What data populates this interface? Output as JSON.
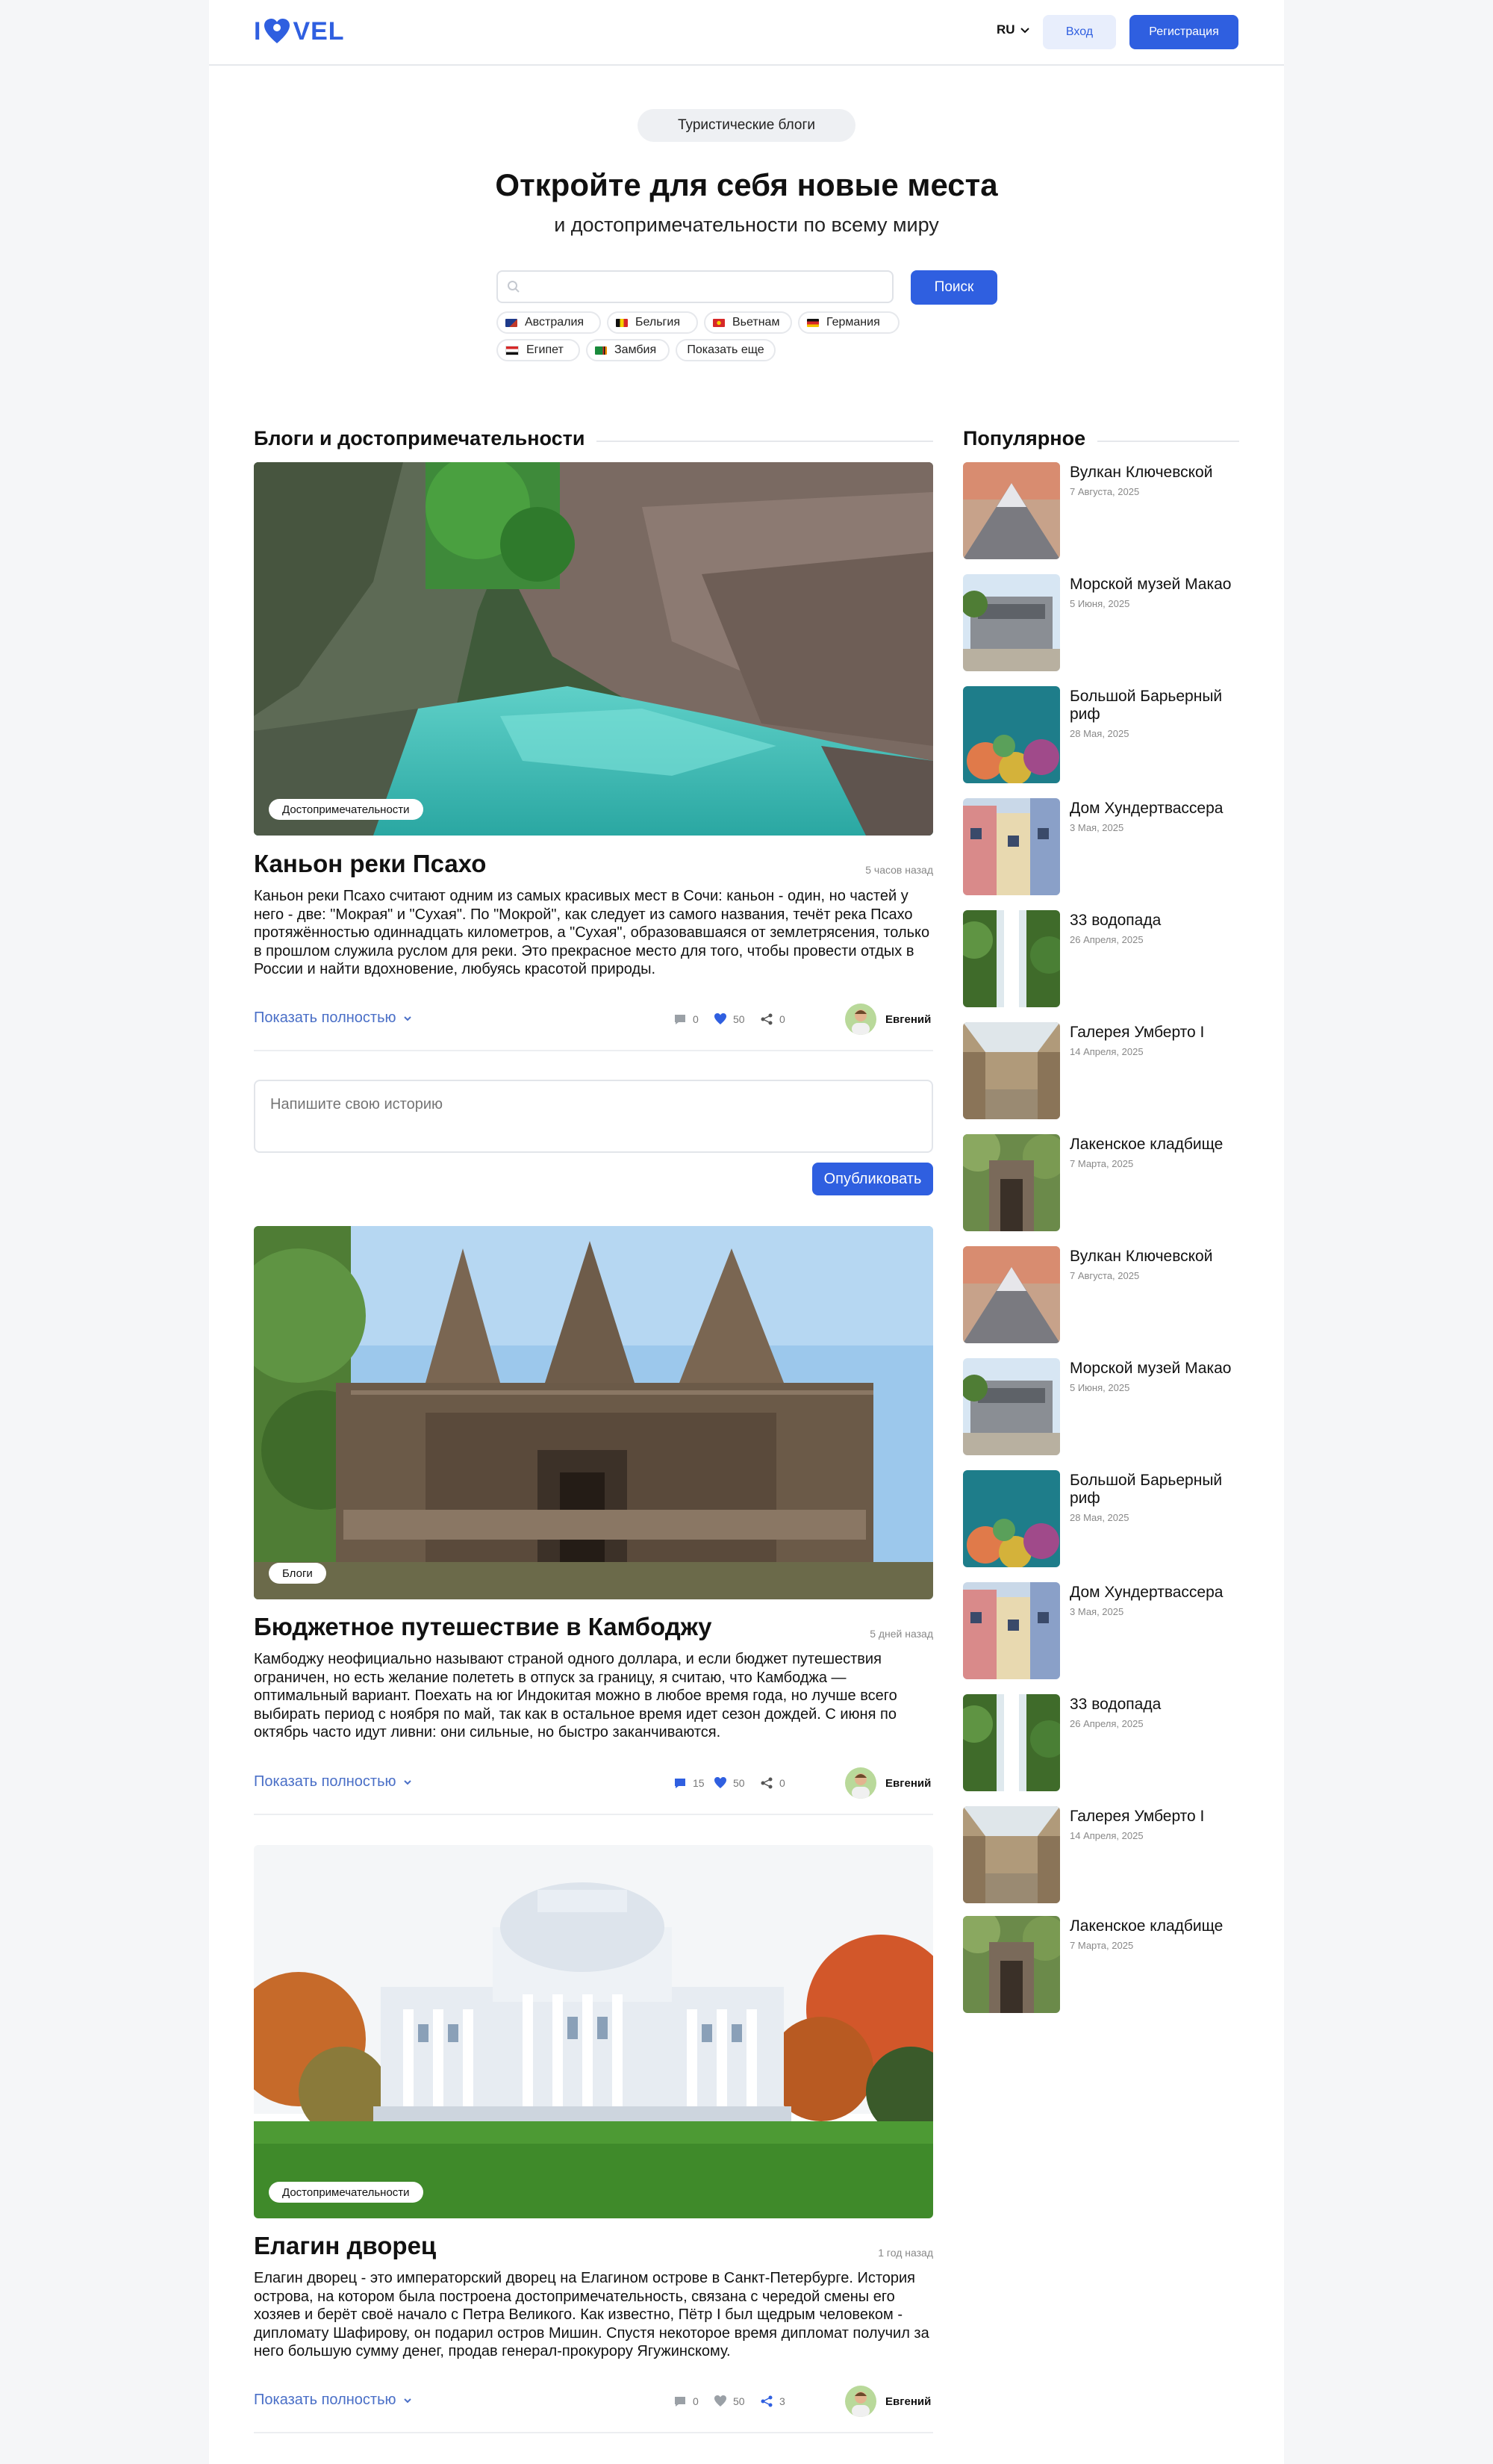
{
  "header": {
    "logo_part1": "I",
    "logo_part2": "VEL",
    "lang": "RU",
    "login_label": "Вход",
    "register_label": "Регистрация"
  },
  "hero": {
    "badge": "Туристические блоги",
    "title": "Откройте для себя новые места",
    "subtitle": "и достопримечательности по всему миру",
    "search_placeholder": "",
    "search_button": "Поиск",
    "countries": [
      "Австралия",
      "Бельгия",
      "Вьетнам",
      "Германия",
      "Египет",
      "Замбия"
    ],
    "show_more": "Показать еще"
  },
  "main": {
    "section_title": "Блоги и достопримечательности",
    "posts": [
      {
        "tag": "Достопримечательности",
        "title": "Каньон реки Псахо",
        "time": "5 часов назад",
        "text": "Каньон реки Псахо считают одним из самых красивых мест в Сочи: каньон - один, но частей у него - две: \"Мокрая\" и \"Сухая\". По \"Мокрой\", как следует из самого названия, течёт река Псахо протяжённостью одиннадцать километров, а \"Сухая\", образовавшаяся от землетрясения, только в прошлом служила руслом для реки. Это прекрасное место для того, чтобы провести отдых в России и найти вдохновение, любуясь красотой природы.",
        "more": "Показать полностью",
        "comments": "0",
        "likes": "50",
        "shares": "0",
        "author": "Евгений"
      },
      {
        "tag": "Блоги",
        "title": "Бюджетное путешествие в Камбоджу",
        "time": "5 дней назад",
        "text": "Камбоджу неофициально называют страной одного доллара, и если бюджет путешествия ограничен, но есть желание полететь в отпуск за границу, я считаю, что Камбоджа — оптимальный вариант. Поехать на юг Индокитая можно в любое время года, но лучше всего выбирать период с ноября по май, так как в остальное время идет сезон дождей. С июня по октябрь часто идут ливни: они сильные, но быстро заканчиваются.",
        "more": "Показать полностью",
        "comments": "15",
        "likes": "50",
        "shares": "0",
        "author": "Евгений"
      },
      {
        "tag": "Достопримечательности",
        "title": "Елагин дворец",
        "time": "1 год назад",
        "text": "Елагин дворец - это императорский дворец на Елагином острове в Санкт-Петербурге. История острова, на котором была построена достопримечательность, связана с чередой смены его хозяев и берёт своё начало с Петра Великого. Как известно, Пётр I был щедрым человеком - дипломату Шафирову, он подарил остров Мишин. Спустя некоторое время дипломат получил за него большую сумму денег, продав генерал-прокурору Ягужинскому.",
        "more": "Показать полностью",
        "comments": "0",
        "likes": "50",
        "shares": "3",
        "author": "Евгений"
      }
    ],
    "story_placeholder": "Напишите свою историю",
    "publish_label": "Опубликовать"
  },
  "sidebar": {
    "title": "Популярное",
    "items": [
      {
        "title": "Вулкан Ключевской",
        "date": "7 Августа, 2025"
      },
      {
        "title": "Морской музей Макао",
        "date": "5 Июня, 2025"
      },
      {
        "title": "Большой Барьерный риф",
        "date": "28 Мая, 2025"
      },
      {
        "title": "Дом Хундертвассера",
        "date": "3 Мая, 2025"
      },
      {
        "title": "33 водопада",
        "date": "26 Апреля, 2025"
      },
      {
        "title": "Галерея Умберто I",
        "date": "14 Апреля, 2025"
      },
      {
        "title": "Лакенское кладбище",
        "date": "7 Марта, 2025"
      },
      {
        "title": "Вулкан Ключевской",
        "date": "7 Августа, 2025"
      },
      {
        "title": "Морской музей Макао",
        "date": "5 Июня, 2025"
      },
      {
        "title": "Большой Барьерный риф",
        "date": "28 Мая, 2025"
      },
      {
        "title": "Дом Хундертвассера",
        "date": "3 Мая, 2025"
      },
      {
        "title": "33 водопада",
        "date": "26 Апреля, 2025"
      },
      {
        "title": "Галерея Умберто I",
        "date": "14 Апреля, 2025"
      },
      {
        "title": "Лакенское кладбище",
        "date": "7 Марта, 2025"
      }
    ]
  },
  "colors": {
    "accent": "#2f5fe0",
    "accent_light": "#e8eefc",
    "link": "#4a6fc7",
    "muted": "#888888"
  }
}
